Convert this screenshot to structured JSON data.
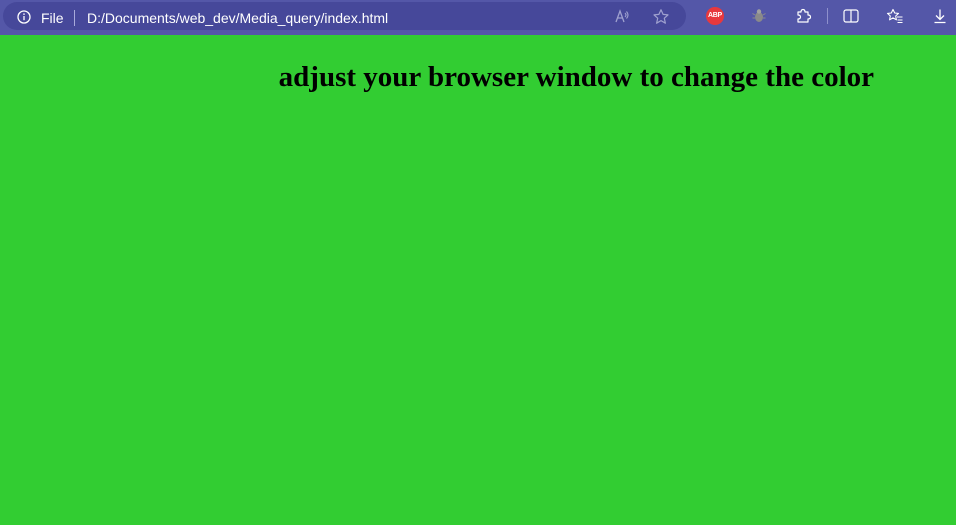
{
  "address_bar": {
    "scheme": "File",
    "url": "D:/Documents/web_dev/Media_query/index.html"
  },
  "toolbar": {
    "icons": [
      "info-icon",
      "read-aloud-icon",
      "favorite-star-icon",
      "adblock-plus-icon",
      "bug-extension-icon",
      "extensions-icon",
      "split-screen-icon",
      "favorites-icon",
      "downloads-icon"
    ],
    "abp_label": "ABP"
  },
  "page": {
    "heading": "adjust your browser window to change the color",
    "background_color": "#32cd32"
  }
}
